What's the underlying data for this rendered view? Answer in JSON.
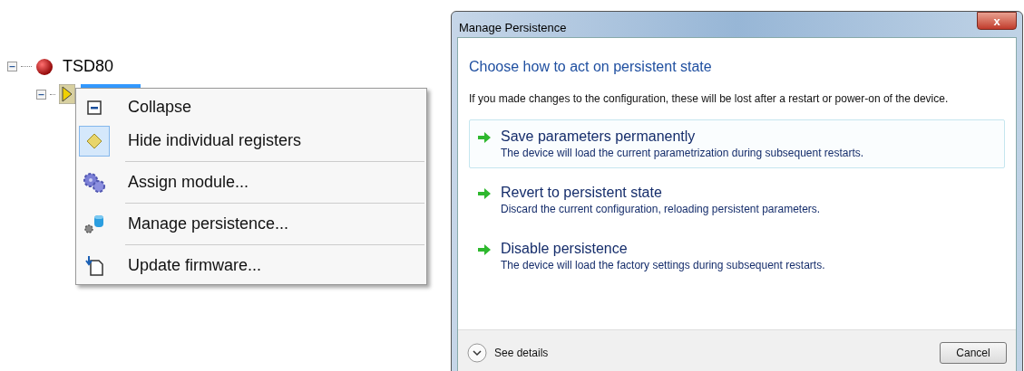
{
  "tree": {
    "root": {
      "label": "TSD80",
      "expanded": true,
      "child": {
        "expanded": true,
        "selected": true
      }
    }
  },
  "context_menu": {
    "items": [
      {
        "kind": "collapse",
        "label": "Collapse",
        "checked": false,
        "separator_after": false
      },
      {
        "kind": "diamond",
        "label": "Hide individual registers",
        "checked": true,
        "separator_after": true
      },
      {
        "kind": "gears",
        "label": "Assign module...",
        "checked": false,
        "separator_after": true
      },
      {
        "kind": "persistence",
        "label": "Manage persistence...",
        "checked": false,
        "separator_after": true
      },
      {
        "kind": "firmware",
        "label": "Update firmware...",
        "checked": false,
        "separator_after": false
      }
    ]
  },
  "dialog": {
    "title": "Manage Persistence",
    "close": "x",
    "heading": "Choose how to act on persistent state",
    "message": "If you made changes to the configuration, these will be lost after a restart or power-on of the device.",
    "options": [
      {
        "label": "Save parameters permanently",
        "description": "The device will load the current parametrization during subsequent restarts.",
        "selected": true
      },
      {
        "label": "Revert to persistent state",
        "description": "Discard the current configuration, reloading persistent parameters.",
        "selected": false
      },
      {
        "label": "Disable persistence",
        "description": "The device will load the factory settings during subsequent restarts.",
        "selected": false
      }
    ],
    "details": "See details",
    "cancel": "Cancel"
  }
}
